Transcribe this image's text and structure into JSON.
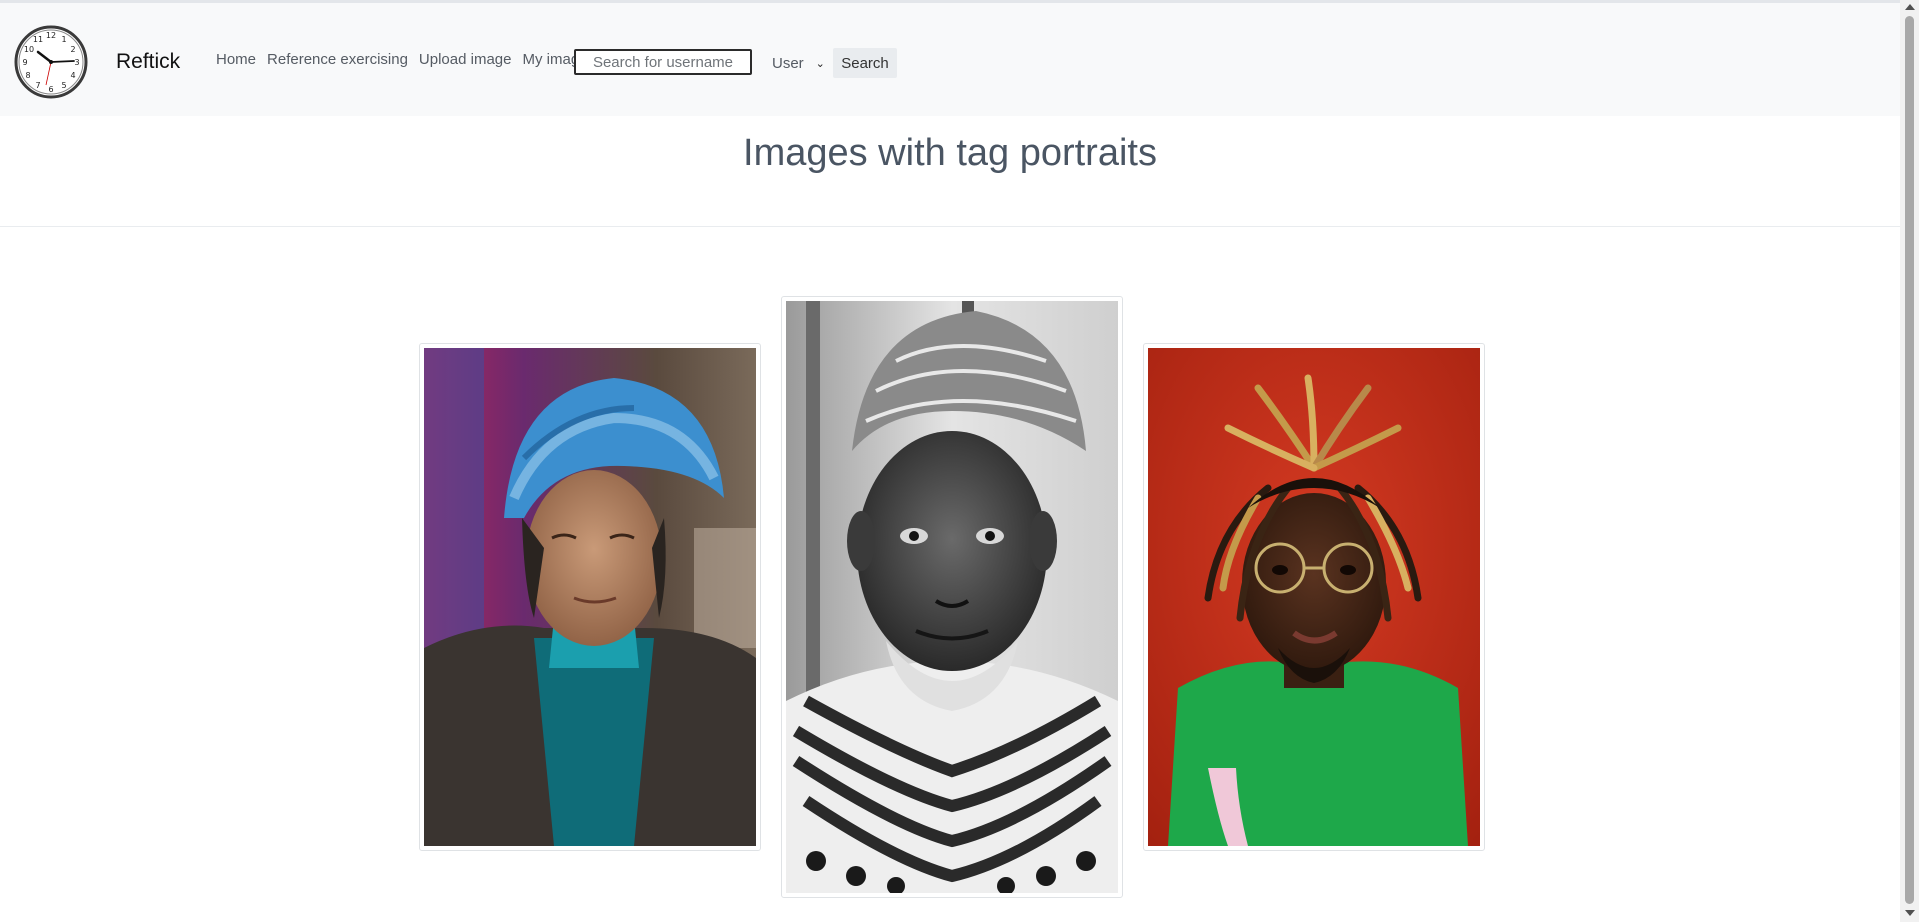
{
  "brand": {
    "name": "Reftick",
    "logo_icon": "clock-icon"
  },
  "nav": {
    "links": [
      "Home",
      "Reference exercising",
      "Upload image",
      "My images"
    ],
    "search_placeholder": "Search for username",
    "select_value": "User",
    "search_button": "Search"
  },
  "page": {
    "title": "Images with tag portraits"
  },
  "gallery": {
    "images": [
      {
        "subject": "elderly woman in blue knit headscarf",
        "style": "color"
      },
      {
        "subject": "elderly man in striped scarf and cap",
        "style": "black-and-white"
      },
      {
        "subject": "young man with dreadlocks and glasses on red background",
        "style": "color"
      }
    ]
  },
  "colors": {
    "navbar_bg": "#f8f9fa",
    "title_text": "#4a5563",
    "button_bg": "#e9ecef"
  }
}
